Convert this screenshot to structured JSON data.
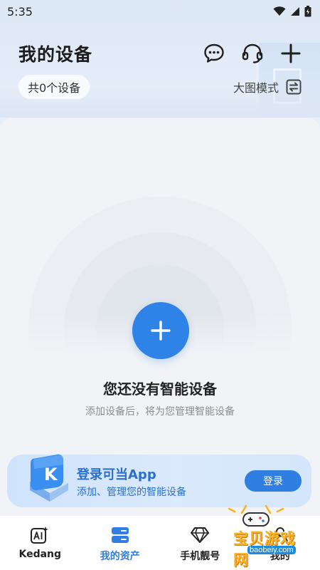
{
  "status_bar": {
    "time": "5:35",
    "icons": [
      "wifi-icon",
      "signal-icon",
      "battery-icon"
    ]
  },
  "header": {
    "title": "我的设备",
    "actions": [
      "message-icon",
      "headset-icon",
      "plus-icon"
    ]
  },
  "device_count": "共0个设备",
  "view_toggle": {
    "label": "大图模式",
    "icon": "swap-icon"
  },
  "empty_state": {
    "title": "您还没有智能设备",
    "subtitle": "添加设备后，将为您管理智能设备",
    "add_icon": "plus-icon"
  },
  "login_banner": {
    "title": "登录可当App",
    "subtitle": "添加、管理您的智能设备",
    "button": "登录",
    "logo_letter": "K"
  },
  "bottom_nav": [
    {
      "label": "Kedang",
      "icon": "ai-icon",
      "active": false
    },
    {
      "label": "我的资产",
      "icon": "assets-icon",
      "active": true
    },
    {
      "label": "手机靓号",
      "icon": "diamond-icon",
      "active": false
    },
    {
      "label": "我的",
      "icon": "profile-icon",
      "active": false
    }
  ],
  "watermark": {
    "text": "宝贝游戏网",
    "url": "baobeiy.com"
  },
  "colors": {
    "accent": "#2f82e6",
    "banner_text": "#2a6fd0",
    "watermark": "#f7b21c"
  }
}
